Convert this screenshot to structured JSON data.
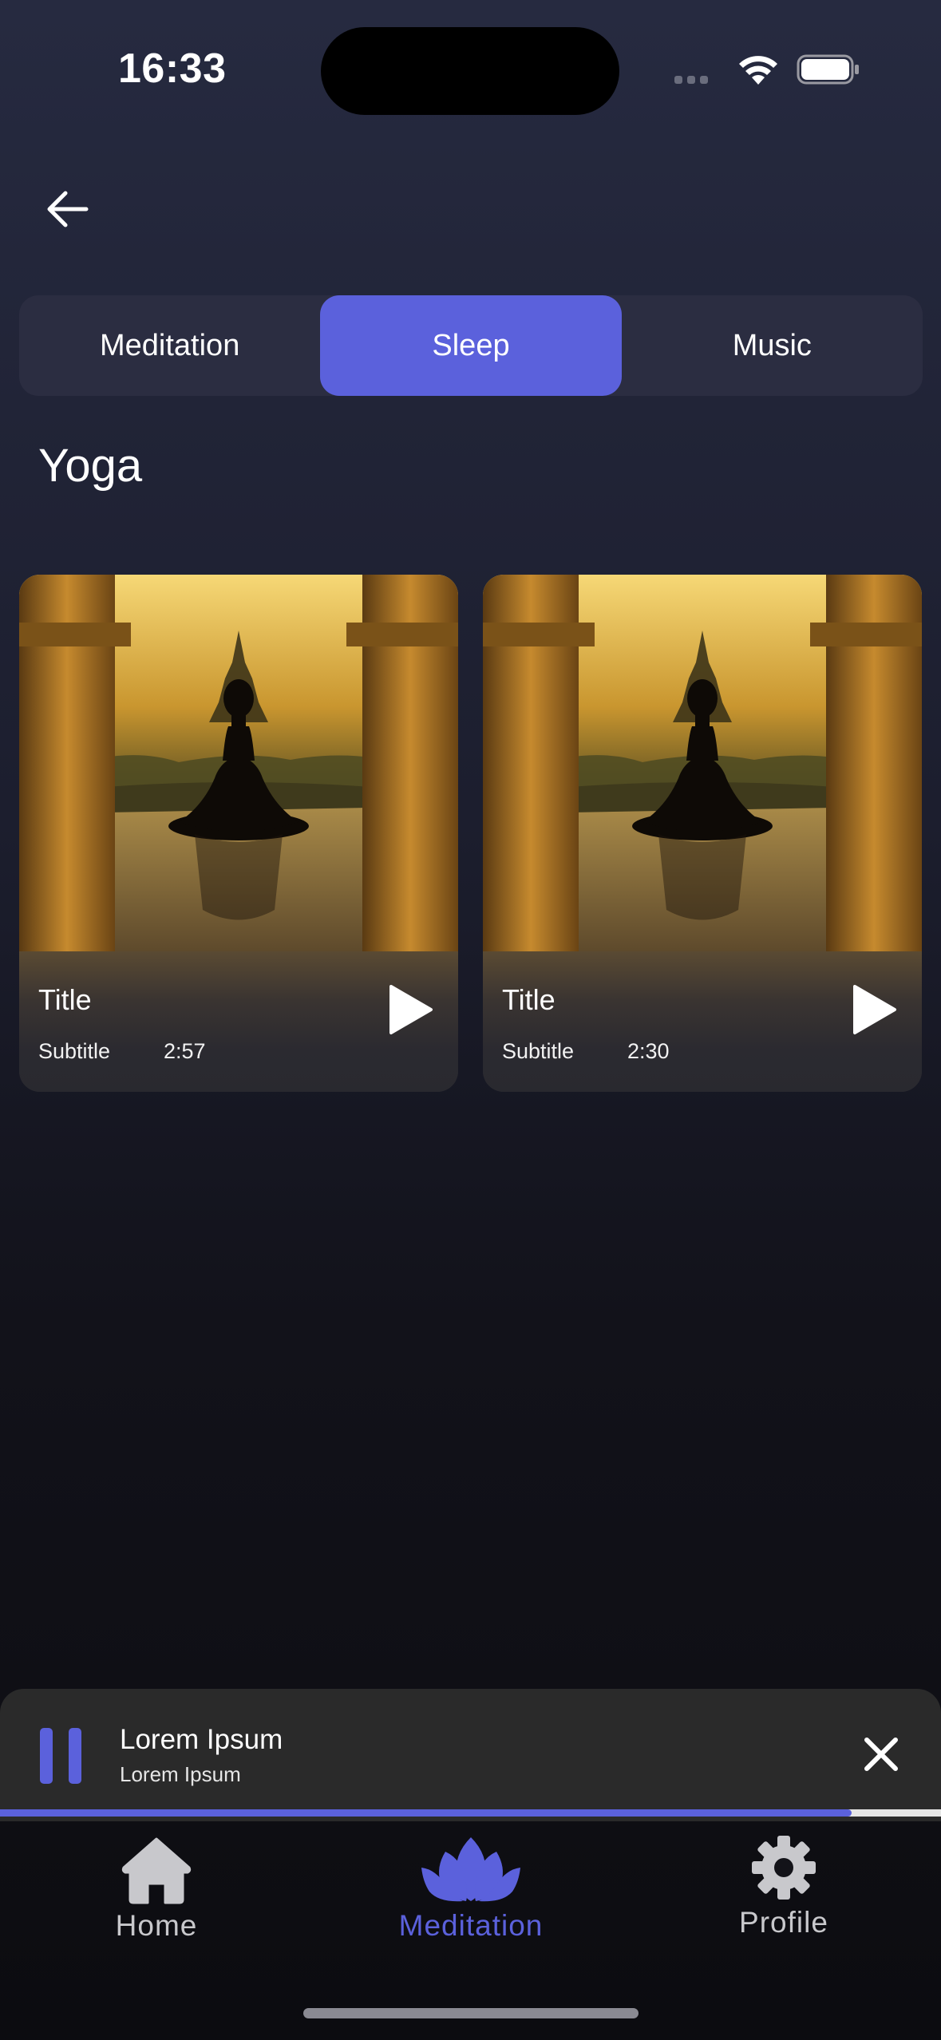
{
  "status_bar": {
    "time": "16:33"
  },
  "tabs": [
    {
      "label": "Meditation",
      "active": false
    },
    {
      "label": "Sleep",
      "active": true
    },
    {
      "label": "Music",
      "active": false
    }
  ],
  "section_title": "Yoga",
  "cards": [
    {
      "title": "Title",
      "subtitle": "Subtitle",
      "duration": "2:57"
    },
    {
      "title": "Title",
      "subtitle": "Subtitle",
      "duration": "2:30"
    }
  ],
  "player": {
    "title": "Lorem Ipsum",
    "subtitle": "Lorem Ipsum",
    "progress": 0.905
  },
  "tab_bar": [
    {
      "label": "Home",
      "icon": "home-icon",
      "active": false
    },
    {
      "label": "Meditation",
      "icon": "lotus-icon",
      "active": true
    },
    {
      "label": "Profile",
      "icon": "gear-icon",
      "active": false
    }
  ],
  "colors": {
    "accent": "#5b61dc",
    "segment_bg": "#2b2d41",
    "player_bg": "#2a2a2a",
    "tab_inactive": "#c8c8cc"
  }
}
